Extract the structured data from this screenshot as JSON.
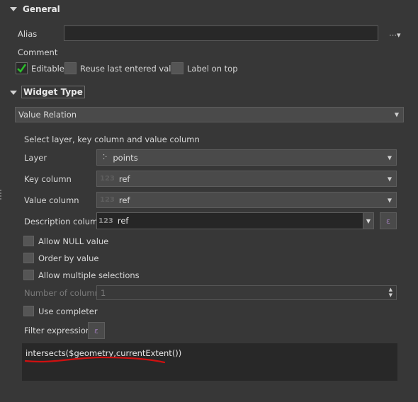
{
  "general": {
    "title": "General"
  },
  "alias": {
    "label": "Alias",
    "value": "",
    "menu_label": "⋯▾"
  },
  "comment": {
    "label": "Comment"
  },
  "checkboxes": {
    "editable": {
      "label": "Editable",
      "checked": true
    },
    "reuse": {
      "label": "Reuse last entered value",
      "checked": false
    },
    "label_on_top": {
      "label": "Label on top",
      "checked": false
    }
  },
  "widget_type": {
    "title": "Widget Type",
    "selected": "Value Relation"
  },
  "value_relation": {
    "heading": "Select layer, key column and value column",
    "layer": {
      "label": "Layer",
      "value": "points",
      "icon": "point-layer-icon"
    },
    "key_column": {
      "label": "Key column",
      "value": "ref",
      "type_icon": "123"
    },
    "value_column": {
      "label": "Value column",
      "value": "ref",
      "type_icon": "123"
    },
    "description_column": {
      "label": "Description column",
      "value": "ref",
      "type_icon": "123"
    },
    "allow_null": {
      "label": "Allow NULL value",
      "checked": false
    },
    "order_by_value": {
      "label": "Order by value",
      "checked": false
    },
    "allow_multiple": {
      "label": "Allow multiple selections",
      "checked": false
    },
    "number_of_columns": {
      "label": "Number of columns",
      "value": "1"
    },
    "use_completer": {
      "label": "Use completer",
      "checked": false
    },
    "filter_expression": {
      "label": "Filter expression",
      "value": "intersects($geometry,currentExtent())"
    }
  },
  "colors": {
    "annotation_underline": "#d01010",
    "panel": "#373737",
    "field": "#282828",
    "check_mark": "#2bbf2b"
  }
}
